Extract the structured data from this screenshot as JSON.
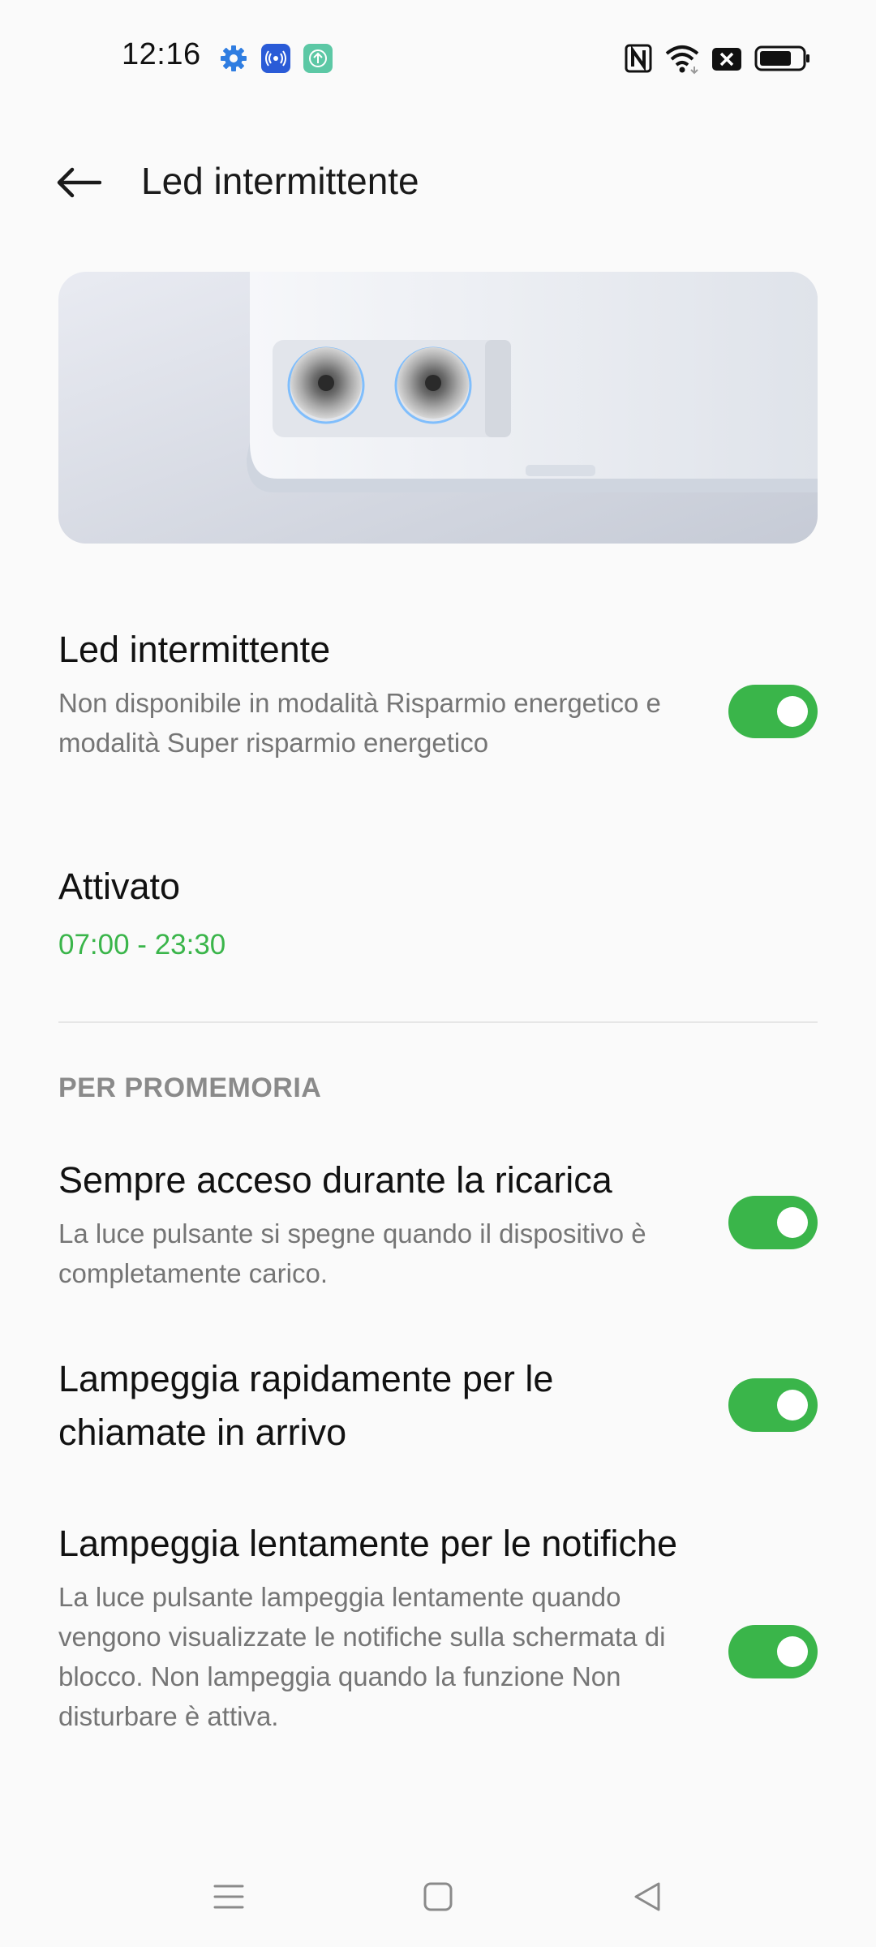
{
  "status_bar": {
    "time": "12:16",
    "left_icons": [
      "gear-icon",
      "nfc-app-icon",
      "upload-app-icon"
    ],
    "right_icons": [
      "nfc-n-icon",
      "wifi-icon",
      "sim-off-icon",
      "battery-icon"
    ],
    "colors": {
      "gear": "#2f7de1",
      "nfc_app": "#2a5bd7",
      "upload_app": "#5cc8a5"
    }
  },
  "header": {
    "back_icon": "back-arrow-icon",
    "title": "Led intermittente"
  },
  "settings": [
    {
      "title": "Led intermittente",
      "subtitle": "Non disponibile in modalità Risparmio energetico e modalità Super risparmio energetico",
      "toggle": true
    },
    {
      "title": "Attivato",
      "time_range": "07:00  - 23:30"
    }
  ],
  "section": {
    "header": "PER PROMEMORIA",
    "items": [
      {
        "title": "Sempre acceso durante la ricarica",
        "subtitle": "La luce pulsante si spegne quando il dispositivo è completamente carico.",
        "toggle": true
      },
      {
        "title": "Lampeggia rapidamente per le chiamate in arrivo",
        "toggle": true
      },
      {
        "title": "Lampeggia lentamente per le notifiche",
        "subtitle": "La luce pulsante lampeggia lentamente quando vengono visualizzate le notifiche sulla schermata di blocco. Non lampeggia quando la funzione Non disturbare è attiva.",
        "toggle": true
      }
    ]
  },
  "nav_bar": {
    "icons": [
      "menu-icon",
      "home-icon",
      "back-triangle-icon"
    ]
  },
  "colors": {
    "accent": "#3ab54a",
    "background": "#fafafa",
    "secondary_text": "#757575",
    "section_header": "#8a8a8a"
  }
}
